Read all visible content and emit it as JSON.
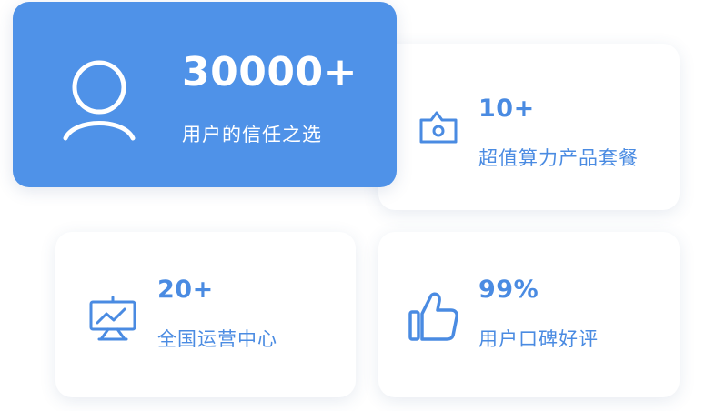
{
  "stats": [
    {
      "id": "users",
      "icon": "user-icon",
      "value": "30000+",
      "label": "用户的信任之选",
      "style": "highlight"
    },
    {
      "id": "plans",
      "icon": "camera-icon",
      "value": "10+",
      "label": "超值算力产品套餐",
      "style": "plain"
    },
    {
      "id": "centers",
      "icon": "presentation-icon",
      "value": "20+",
      "label": "全国运营中心",
      "style": "plain"
    },
    {
      "id": "rating",
      "icon": "thumbs-up-icon",
      "value": "99%",
      "label": "用户口碑好评",
      "style": "plain"
    }
  ],
  "colors": {
    "accent": "#4f92e8",
    "accent_text": "#4a8be2",
    "card_background": "#ffffff",
    "highlight_text": "#ffffff"
  }
}
